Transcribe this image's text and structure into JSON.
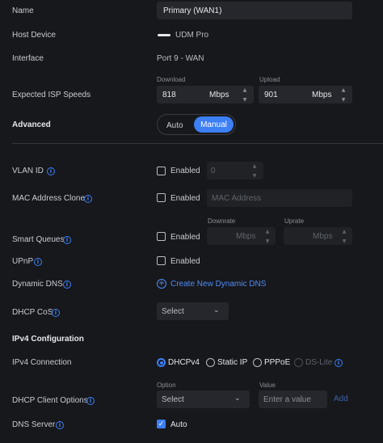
{
  "name": {
    "label": "Name",
    "value": "Primary (WAN1)"
  },
  "host_device": {
    "label": "Host Device",
    "value": "UDM Pro"
  },
  "interface": {
    "label": "Interface",
    "value": "Port 9 - WAN"
  },
  "isp_speeds": {
    "label": "Expected ISP Speeds",
    "download_label": "Download",
    "download_value": "818",
    "download_unit": "Mbps",
    "upload_label": "Upload",
    "upload_value": "901",
    "upload_unit": "Mbps"
  },
  "advanced": {
    "label": "Advanced",
    "options": [
      "Auto",
      "Manual"
    ],
    "selected": "Manual"
  },
  "vlan_id": {
    "label": "VLAN ID",
    "enabled_label": "Enabled",
    "value": "0"
  },
  "mac_clone": {
    "label": "MAC Address Clone",
    "enabled_label": "Enabled",
    "placeholder": "MAC Address"
  },
  "smart_queues": {
    "label": "Smart Queues",
    "enabled_label": "Enabled",
    "downrate_label": "Downrate",
    "downrate_unit": "Mbps",
    "uprate_label": "Uprate",
    "uprate_unit": "Mbps"
  },
  "upnp": {
    "label": "UPnP",
    "enabled_label": "Enabled"
  },
  "dynamic_dns": {
    "label": "Dynamic DNS",
    "link": "Create New Dynamic DNS"
  },
  "dhcp_cos": {
    "label": "DHCP CoS",
    "select": "Select"
  },
  "ipv4": {
    "section": "IPv4 Configuration",
    "connection_label": "IPv4 Connection",
    "options": [
      "DHCPv4",
      "Static IP",
      "PPPoE",
      "DS-Lite"
    ],
    "selected": "DHCPv4"
  },
  "dhcp_client_options": {
    "label": "DHCP Client Options",
    "option_label": "Option",
    "option_select": "Select",
    "value_label": "Value",
    "value_placeholder": "Enter a value",
    "add": "Add"
  },
  "dns_server": {
    "label": "DNS Server",
    "auto_label": "Auto",
    "checked": true
  },
  "colors": {
    "accent": "#3d7ff5",
    "background": "#17181c",
    "field": "#25272c"
  }
}
